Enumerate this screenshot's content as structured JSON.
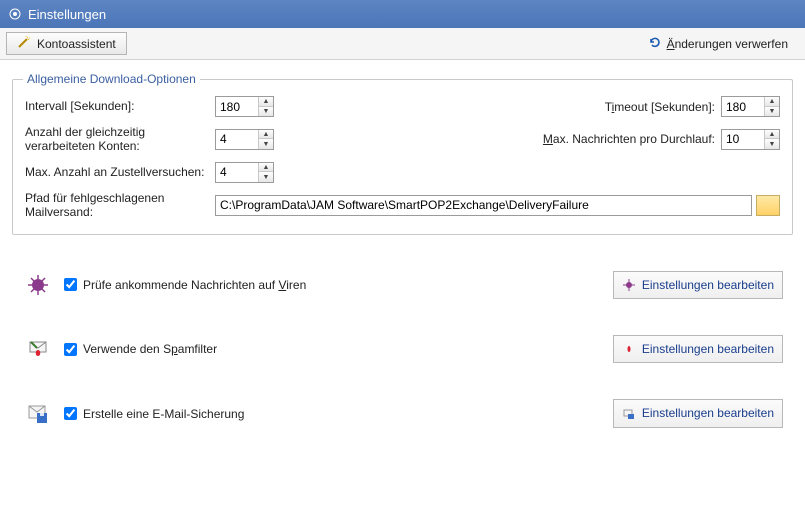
{
  "title": "Einstellungen",
  "toolbar": {
    "wizard": "Kontoassistent",
    "discard": "Änderungen verwerfen"
  },
  "group": {
    "legend": "Allgemeine Download-Optionen",
    "interval_label": "Intervall [Sekunden]:",
    "interval_value": "180",
    "timeout_label_pre": "T",
    "timeout_label_u": "i",
    "timeout_label_post": "meout [Sekunden]:",
    "timeout_value": "180",
    "accounts_label": "Anzahl der gleichzeitig verarbeiteten Konten:",
    "accounts_value": "4",
    "maxmsg_label_u": "M",
    "maxmsg_label_post": "ax. Nachrichten pro Durchlauf:",
    "maxmsg_value": "10",
    "maxdeliv_label": "Max. Anzahl an Zustellversuchen:",
    "maxdeliv_value": "4",
    "path_label": "Pfad für fehlgeschlagenen Mailversand:",
    "path_value": "C:\\ProgramData\\JAM Software\\SmartPOP2Exchange\\DeliveryFailure"
  },
  "modules": {
    "virus_pre": "Prüfe ankommende Nachrichten auf ",
    "virus_u": "V",
    "virus_post": "iren",
    "spam_pre": "Verwende den S",
    "spam_u": "p",
    "spam_post": "amfilter",
    "backup_pre": "Erstelle eine E-Mail-Sicherun",
    "backup_u": "g",
    "backup_post": "",
    "edit": "Einstellungen bearbeiten"
  }
}
